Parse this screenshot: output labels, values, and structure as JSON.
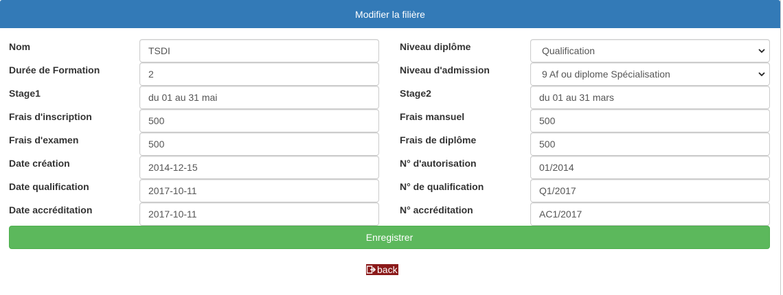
{
  "header": {
    "title": "Modifier la filière"
  },
  "left_fields": [
    {
      "label": "Nom",
      "value": "TSDI"
    },
    {
      "label": "Durée de Formation",
      "value": "2"
    },
    {
      "label": "Stage1",
      "value": "du 01 au 31 mai"
    },
    {
      "label": "Frais d'inscription",
      "value": "500"
    },
    {
      "label": "Frais d'examen",
      "value": "500"
    },
    {
      "label": "Date création",
      "value": "2014-12-15"
    },
    {
      "label": "Date qualification",
      "value": "2017-10-11"
    },
    {
      "label": "Date accréditation",
      "value": "2017-10-11"
    }
  ],
  "right_fields": [
    {
      "label": "Niveau diplôme",
      "value": "Qualification"
    },
    {
      "label": "Niveau d'admission",
      "value": "9 Af ou diplome Spécialisation"
    },
    {
      "label": "Stage2",
      "value": "du 01 au 31 mars"
    },
    {
      "label": "Frais mansuel",
      "value": "500"
    },
    {
      "label": "Frais de diplôme",
      "value": "500"
    },
    {
      "label": "N° d'autorisation",
      "value": "01/2014"
    },
    {
      "label": "N° de qualification",
      "value": "Q1/2017"
    },
    {
      "label": "N° accréditation",
      "value": "AC1/2017"
    }
  ],
  "actions": {
    "save_label": "Enregistrer",
    "back_label": "back"
  },
  "colors": {
    "header_bg": "#337ab7",
    "save_bg": "#5cb85c",
    "back_bg": "#8b1a1a"
  }
}
